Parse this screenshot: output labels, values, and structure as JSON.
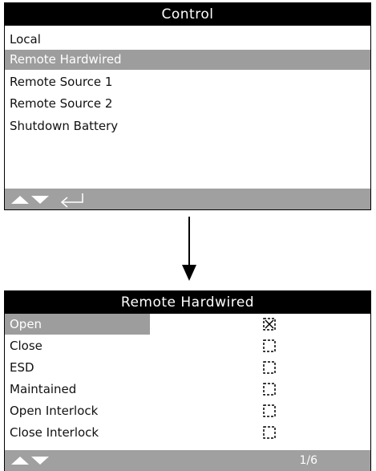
{
  "control_menu": {
    "title": "Control",
    "items": [
      {
        "label": "Local",
        "selected": false
      },
      {
        "label": "Remote Hardwired",
        "selected": true
      },
      {
        "label": "Remote Source 1",
        "selected": false
      },
      {
        "label": "Remote Source 2",
        "selected": false
      },
      {
        "label": "Shutdown Battery",
        "selected": false
      }
    ],
    "footer_icons": [
      "up-arrow-icon",
      "down-arrow-icon",
      "enter-icon"
    ]
  },
  "transition_icon": "down-arrow-icon",
  "remote_hardwired": {
    "title": "Remote Hardwired",
    "options": [
      {
        "label": "Open",
        "checked": true,
        "selected": true
      },
      {
        "label": "Close",
        "checked": false,
        "selected": false
      },
      {
        "label": "ESD",
        "checked": false,
        "selected": false
      },
      {
        "label": "Maintained",
        "checked": false,
        "selected": false
      },
      {
        "label": "Open Interlock",
        "checked": false,
        "selected": false
      },
      {
        "label": "Close Interlock",
        "checked": false,
        "selected": false
      }
    ],
    "footer_icons": [
      "up-arrow-icon",
      "down-arrow-icon"
    ],
    "page_indicator": "1/6"
  },
  "colors": {
    "title_bg": "#000000",
    "selection_bg": "#9d9d9d",
    "footer_bg": "#a0a0a0"
  }
}
